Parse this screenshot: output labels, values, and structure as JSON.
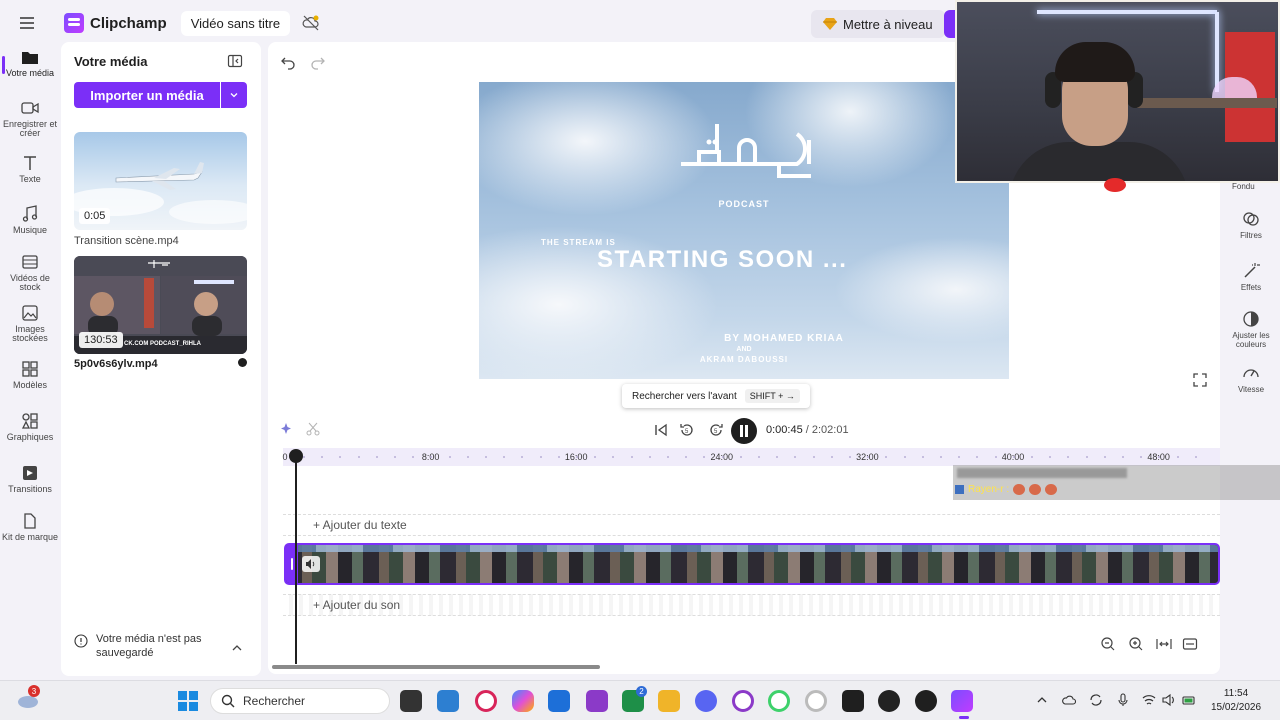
{
  "app": {
    "name": "Clipchamp",
    "project_title": "Vidéo sans titre",
    "upgrade_label": "Mettre à niveau",
    "colors": {
      "accent": "#7b2ff7",
      "background": "#f3f2f8"
    }
  },
  "left_rail": [
    {
      "label": "Votre média",
      "icon": "folder-icon",
      "active": true
    },
    {
      "label": "Enregistrer et créer",
      "icon": "camera-icon"
    },
    {
      "label": "Texte",
      "icon": "text-icon"
    },
    {
      "label": "Musique",
      "icon": "music-icon"
    },
    {
      "label": "Vidéos de stock",
      "icon": "film-icon"
    },
    {
      "label": "Images stockées",
      "icon": "image-icon"
    },
    {
      "label": "Modèles",
      "icon": "templates-icon"
    },
    {
      "label": "Graphiques",
      "icon": "shapes-icon"
    },
    {
      "label": "Transitions",
      "icon": "transitions-icon"
    },
    {
      "label": "Kit de marque",
      "icon": "brand-kit-icon"
    }
  ],
  "media_panel": {
    "title": "Votre média",
    "import_label": "Importer un média",
    "items": [
      {
        "filename": "Transition scène.mp4",
        "duration": "0:05"
      },
      {
        "filename": "5p0v6s6ylv.mp4",
        "duration": "130:53",
        "overlay_text": "CK.COM PODCAST_RIHLA"
      }
    ],
    "save_warning": "Votre média n'est pas sauvegardé"
  },
  "preview": {
    "podcast_label": "PODCAST",
    "stream_is": "THE STREAM IS",
    "starting_soon": "STARTING SOON ...",
    "by_line": "BY MOHAMED KRIAA",
    "and_line": "AND",
    "akram_line": "AKRAM DABOUSSI"
  },
  "tooltip": {
    "label": "Rechercher vers l'avant",
    "shortcut": "SHIFT + →"
  },
  "right_rail": [
    {
      "label": "Fondu",
      "icon": "fade-icon"
    },
    {
      "label": "Filtres",
      "icon": "filters-icon"
    },
    {
      "label": "Effets",
      "icon": "effects-icon"
    },
    {
      "label": "Ajuster les couleurs",
      "icon": "adjust-colors-icon"
    },
    {
      "label": "Vitesse",
      "icon": "speed-icon"
    }
  ],
  "playback": {
    "current_time": "0:00:45",
    "total_time": "/ 2:02:01",
    "playing": true
  },
  "timeline": {
    "ruler_labels": [
      "0",
      "8:00",
      "16:00",
      "24:00",
      "32:00",
      "40:00",
      "48:00"
    ],
    "add_text_label": "+ Ajouter du texte",
    "add_audio_label": "+ Ajouter du son"
  },
  "chat_overlay": {
    "username": "Rayen-r :"
  },
  "taskbar": {
    "search_placeholder": "Rechercher",
    "weather_badge": "3",
    "teams_badge": "2",
    "time": "11:54",
    "date": "15/02/2026"
  }
}
